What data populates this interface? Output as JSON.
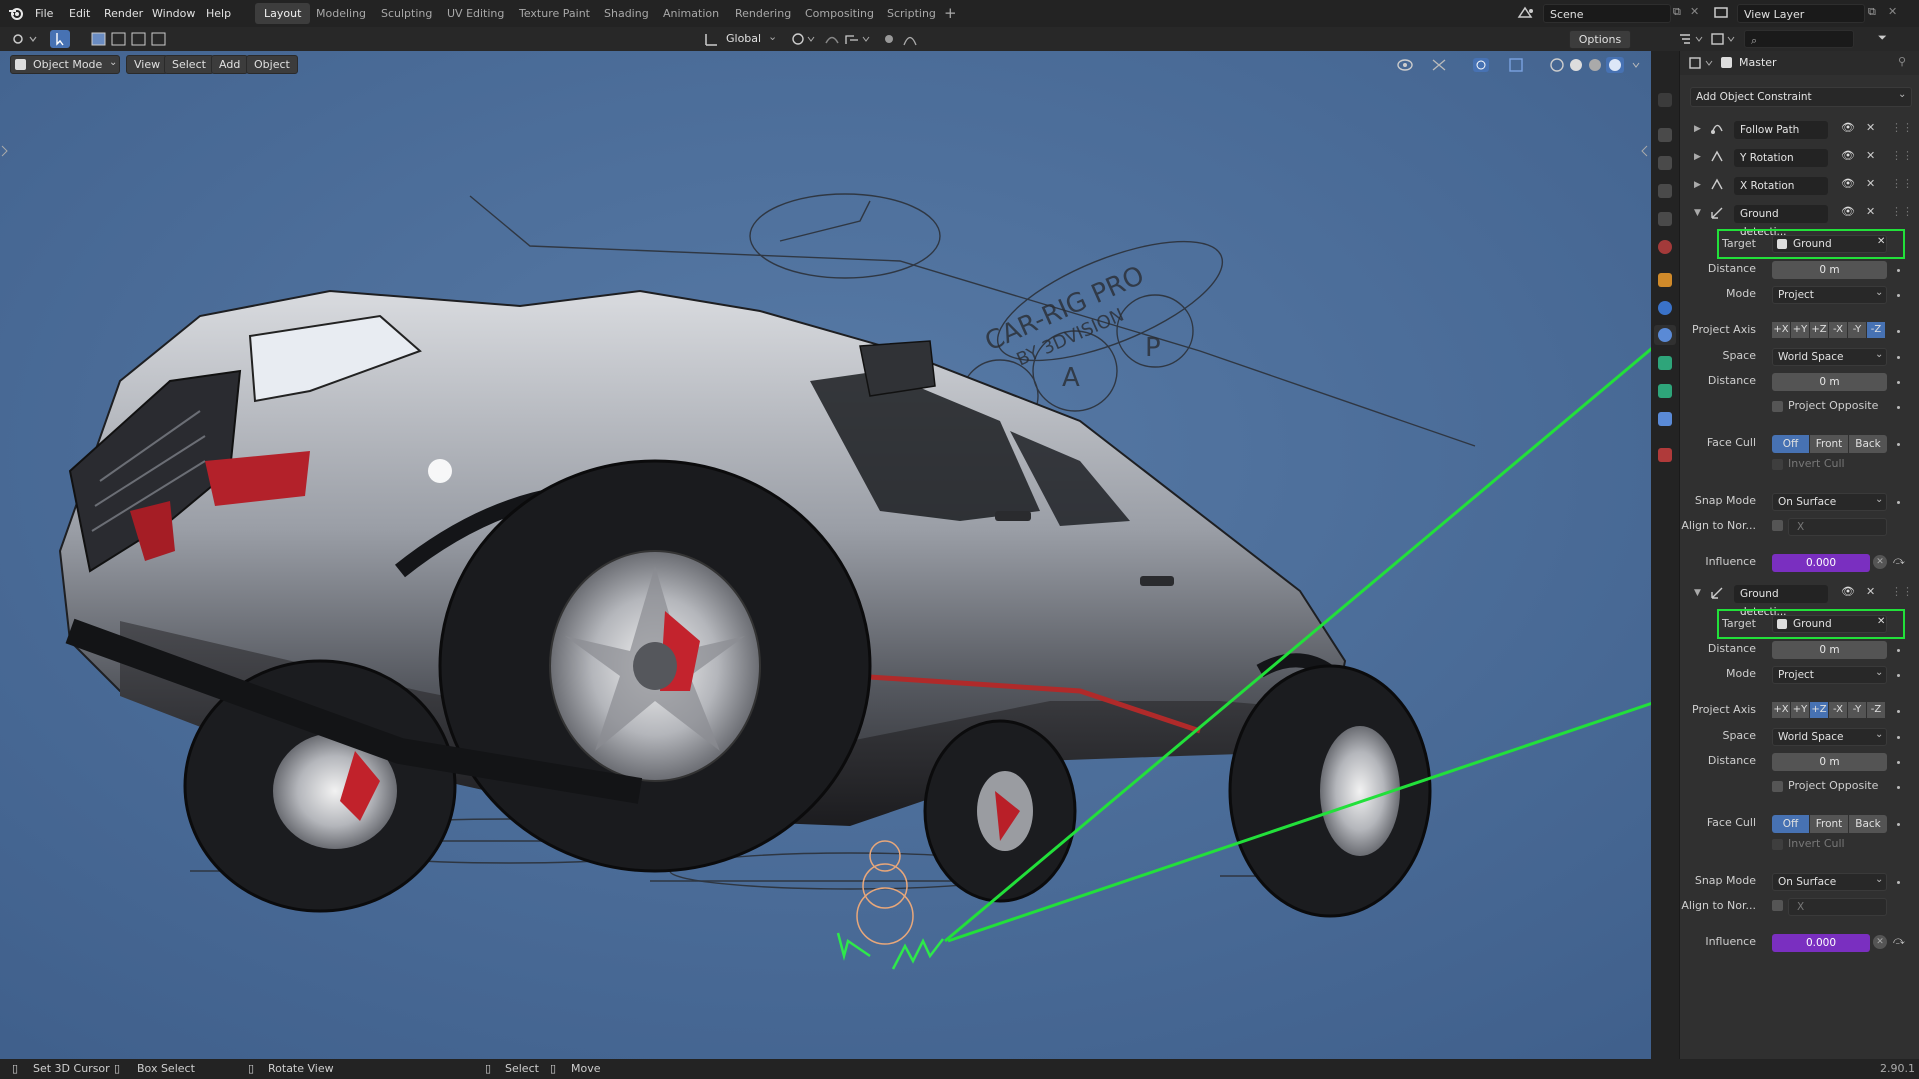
{
  "menu": {
    "items": [
      "File",
      "Edit",
      "Render",
      "Window",
      "Help"
    ]
  },
  "workspaces": [
    "Layout",
    "Modeling",
    "Sculpting",
    "UV Editing",
    "Texture Paint",
    "Shading",
    "Animation",
    "Rendering",
    "Compositing",
    "Scripting"
  ],
  "active_workspace": "Layout",
  "scene": {
    "name": "Scene",
    "view_layer": "View Layer"
  },
  "toolbar": {
    "orientation": "Global",
    "options": "Options"
  },
  "viewport": {
    "mode": "Object Mode",
    "menus": [
      "View",
      "Select",
      "Add",
      "Object"
    ],
    "watermark_line1": "CAR-RIG PRO",
    "watermark_line2": "BY 3DVISION",
    "watermark_letters": [
      "A",
      "P"
    ]
  },
  "properties": {
    "object_name": "Master",
    "add_constraint": "Add Object Constraint",
    "constraints": [
      {
        "name": "Follow Path"
      },
      {
        "name": "Y Rotation"
      },
      {
        "name": "X Rotation"
      }
    ],
    "shrinkwrap": [
      {
        "name": "Ground detecti...",
        "labels": {
          "target": "Target",
          "distance": "Distance",
          "mode": "Mode",
          "project_axis": "Project Axis",
          "space": "Space",
          "distance2": "Distance",
          "face_cull": "Face Cull",
          "snap_mode": "Snap Mode",
          "align": "Align to Nor...",
          "influence": "Influence"
        },
        "target": "Ground",
        "distance": "0 m",
        "mode": "Project",
        "axes": [
          "+X",
          "+Y",
          "+Z",
          "-X",
          "-Y",
          "-Z"
        ],
        "space": "World Space",
        "distance2": "0 m",
        "project_opposite": "Project Opposite",
        "face_cull": [
          "Off",
          "Front",
          "Back"
        ],
        "invert_cull": "Invert Cull",
        "snap_mode": "On Surface",
        "align_axis": "X",
        "influence": "0.000"
      },
      {
        "name": "Ground detecti...",
        "labels": {
          "target": "Target",
          "distance": "Distance",
          "mode": "Mode",
          "project_axis": "Project Axis",
          "space": "Space",
          "distance2": "Distance",
          "face_cull": "Face Cull",
          "snap_mode": "Snap Mode",
          "align": "Align to Nor...",
          "influence": "Influence"
        },
        "target": "Ground",
        "distance": "0 m",
        "mode": "Project",
        "axes": [
          "+X",
          "+Y",
          "+Z",
          "-X",
          "-Y",
          "-Z"
        ],
        "space": "World Space",
        "distance2": "0 m",
        "project_opposite": "Project Opposite",
        "face_cull": [
          "Off",
          "Front",
          "Back"
        ],
        "invert_cull": "Invert Cull",
        "snap_mode": "On Surface",
        "align_axis": "X",
        "influence": "0.000"
      }
    ]
  },
  "statusbar": {
    "items": [
      "Set 3D Cursor",
      "Box Select",
      "Rotate View",
      "Select",
      "Move"
    ],
    "version": "2.90.1"
  },
  "colors": {
    "highlight": "#22e03a",
    "influence": "#7a2fc0",
    "accent": "#4772b3",
    "sky": "#4b6d99"
  }
}
